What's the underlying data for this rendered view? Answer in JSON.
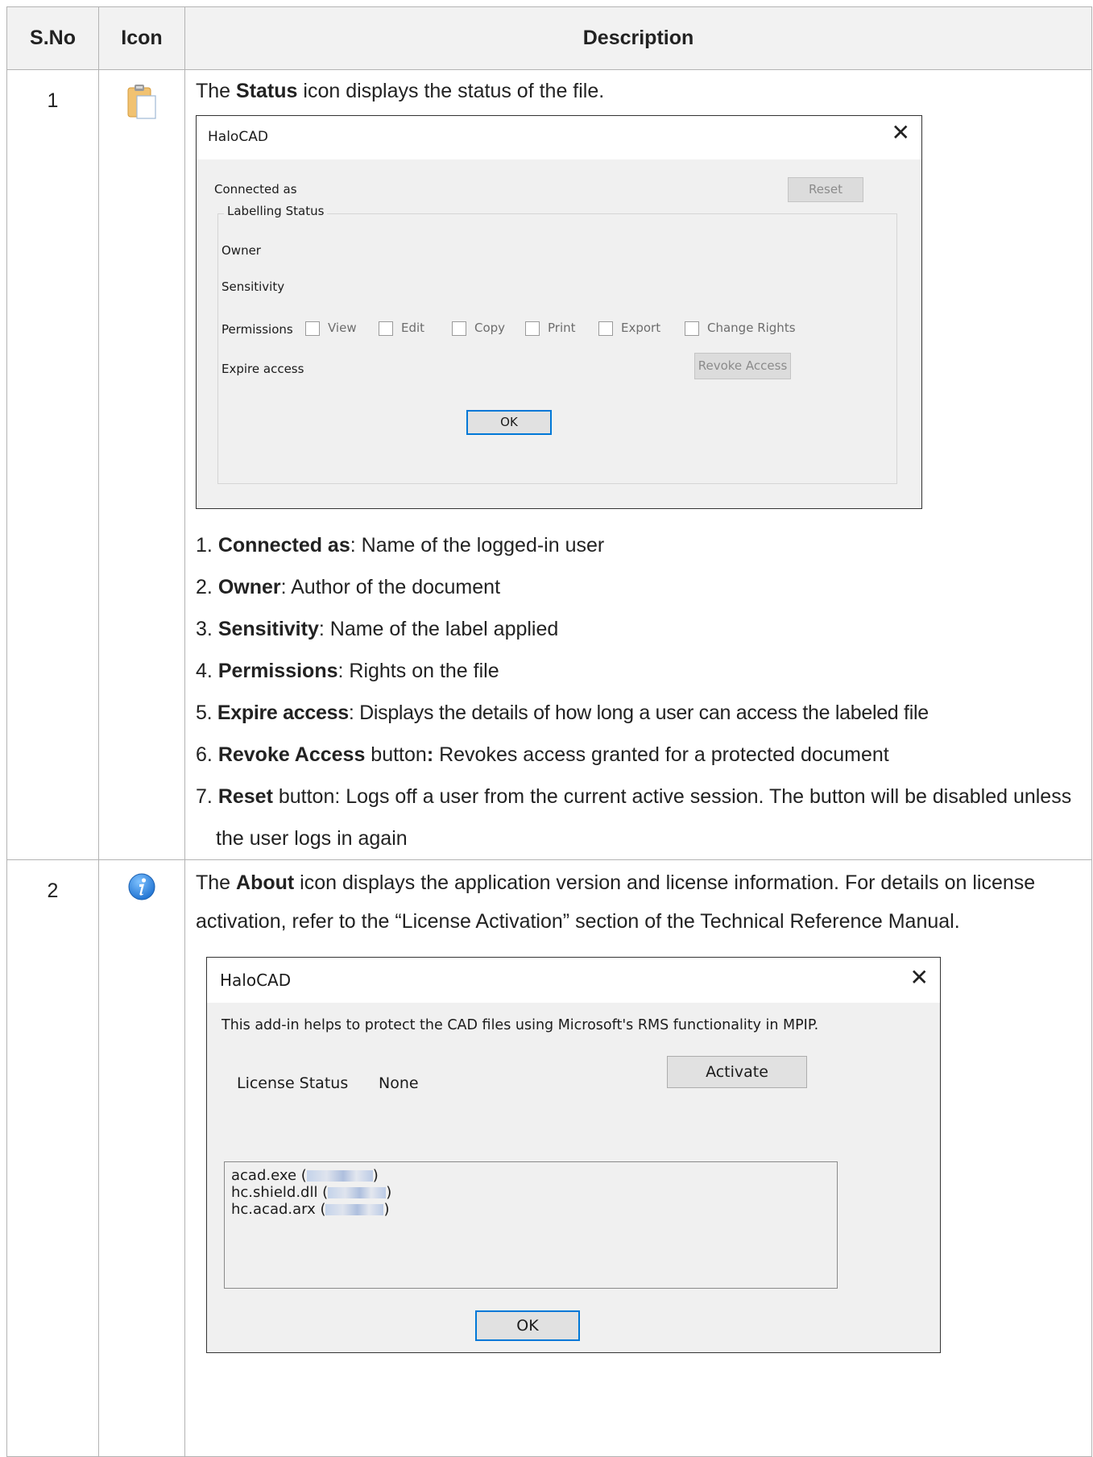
{
  "table": {
    "headers": {
      "sno": "S.No",
      "icon": "Icon",
      "description": "Description"
    },
    "rows": [
      {
        "sno": "1",
        "icon": "clipboard-icon",
        "intro": {
          "pre": "The ",
          "bold": "Status",
          "post": " icon displays the status of the file."
        },
        "dialog": {
          "title": "HaloCAD",
          "connected_as": "Connected as",
          "reset": "Reset",
          "group_label": "Labelling Status",
          "owner": "Owner",
          "sensitivity": "Sensitivity",
          "permissions_label": "Permissions",
          "permissions": [
            "View",
            "Edit",
            "Copy",
            "Print",
            "Export",
            "Change Rights"
          ],
          "expire_access": "Expire access",
          "revoke_access": "Revoke Access",
          "ok": "OK"
        },
        "steps": [
          {
            "num": "1.",
            "term": "Connected as",
            "text": ": Name of the logged-in user"
          },
          {
            "num": "2.",
            "term": "Owner",
            "text": ": Author of the document"
          },
          {
            "num": "3.",
            "term": "Sensitivity",
            "text": ": Name of the label applied"
          },
          {
            "num": "4.",
            "term": "Permissions",
            "text": ": Rights on the file"
          },
          {
            "num": "5.",
            "term": "Expire access",
            "text": ": Displays the details of how long a user can access the labeled file"
          },
          {
            "num": "6.",
            "term": "Revoke Access",
            "mid": " button",
            "colon": ":",
            "text": " Revokes access granted for a protected document"
          },
          {
            "num": "7.",
            "term": "Reset",
            "text": " button: Logs off a user from the current active session. The button will be disabled unless the user logs in again"
          }
        ]
      },
      {
        "sno": "2",
        "icon": "info-icon",
        "intro": {
          "pre": "The ",
          "bold": "About",
          "post": " icon displays the application version and license information. For details on license activation, refer to the “License Activation” section of the Technical Reference Manual."
        },
        "dialog": {
          "title": "HaloCAD",
          "message": "This add-in helps to protect the CAD files using Microsoft's RMS functionality in MPIP.",
          "license_label": "License Status",
          "license_value": "None",
          "activate": "Activate",
          "modules": [
            {
              "name": "acad.exe (",
              "close": ")"
            },
            {
              "name": "hc.shield.dll (",
              "close": ")"
            },
            {
              "name": "hc.acad.arx (",
              "close": ")"
            }
          ],
          "ok": "OK"
        }
      }
    ]
  },
  "colors": {
    "accent": "#0078d7",
    "border": "#b3b3b3",
    "header_bg": "#f2f2f2",
    "info_blue": "#2f8be0"
  }
}
